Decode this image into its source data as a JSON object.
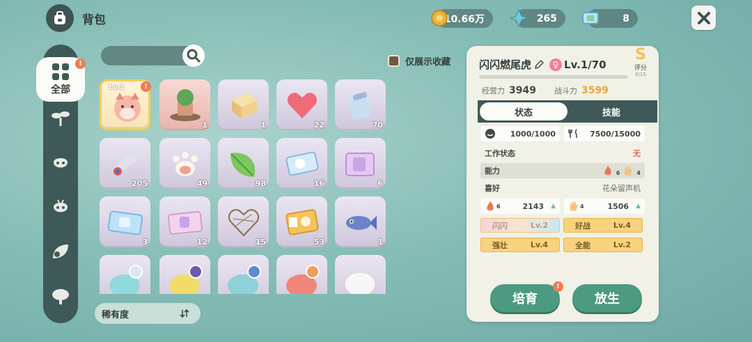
{
  "header": {
    "title": "背包"
  },
  "currency": [
    {
      "name": "coin",
      "value": "10.66万",
      "color": "#e7b43f"
    },
    {
      "name": "crystal",
      "value": "265",
      "color": "#6fc8d6"
    },
    {
      "name": "ticket",
      "value": "8",
      "color": "#9ed9e8"
    }
  ],
  "sidebar": {
    "selected_label": "全部",
    "selected_badge": "!"
  },
  "filter": {
    "favorites_label": "仅展示收藏",
    "checked": false
  },
  "grid": {
    "items": [
      {
        "name": "tiger-pet",
        "count": "",
        "level": "Lv.1",
        "selected": true,
        "badge": "!"
      },
      {
        "name": "treehouse-decor",
        "count": "1"
      },
      {
        "name": "box-item",
        "count": "1"
      },
      {
        "name": "heart-item",
        "count": "22"
      },
      {
        "name": "jar-item",
        "count": "70"
      },
      {
        "name": "telescope-item",
        "count": "205"
      },
      {
        "name": "paw-item",
        "count": "49"
      },
      {
        "name": "leaf-item",
        "count": "98"
      },
      {
        "name": "ticket-blue",
        "count": "16"
      },
      {
        "name": "ticket-pink-card",
        "count": "6"
      },
      {
        "name": "ice-ticket",
        "count": "3"
      },
      {
        "name": "ticket-pink",
        "count": "12"
      },
      {
        "name": "heart-basket",
        "count": "15"
      },
      {
        "name": "music-ticket",
        "count": "53"
      },
      {
        "name": "fish-item",
        "count": "1"
      },
      {
        "name": "slime-cyan",
        "count": ""
      },
      {
        "name": "slime-yellow",
        "count": ""
      },
      {
        "name": "slime-blue",
        "count": ""
      },
      {
        "name": "slime-red",
        "count": ""
      },
      {
        "name": "slime-white",
        "count": ""
      }
    ]
  },
  "sort": {
    "label": "稀有度"
  },
  "pet": {
    "name": "闪闪燃尾虎",
    "level": "Lv.1/70",
    "grade": "S",
    "grade_label": "评分",
    "grade_progress": "0/15",
    "business_label": "经营力",
    "business_value": "3949",
    "combat_label": "战斗力",
    "combat_value": "3599",
    "tabs": [
      "状态",
      "技能"
    ],
    "hunger": "1000/1000",
    "stamina": "7500/15000",
    "work_label": "工作状态",
    "work_value": "无",
    "ability_label": "能力",
    "ability_fire": "6",
    "ability_hand": "4",
    "like_label": "喜好",
    "like_value": "花朵留声机",
    "stat_fire": "2143",
    "stat_fire_lv": "6",
    "stat_hand": "1506",
    "stat_hand_lv": "4",
    "traits": [
      {
        "name": "闪闪",
        "lv": "Lv.2"
      },
      {
        "name": "好战",
        "lv": "Lv.4"
      },
      {
        "name": "强壮",
        "lv": "Lv.4"
      },
      {
        "name": "全能",
        "lv": "Lv.2"
      }
    ],
    "xp_fraction": 0
  },
  "buttons": {
    "foster": "培育",
    "release": "放生",
    "foster_badge": "!"
  }
}
